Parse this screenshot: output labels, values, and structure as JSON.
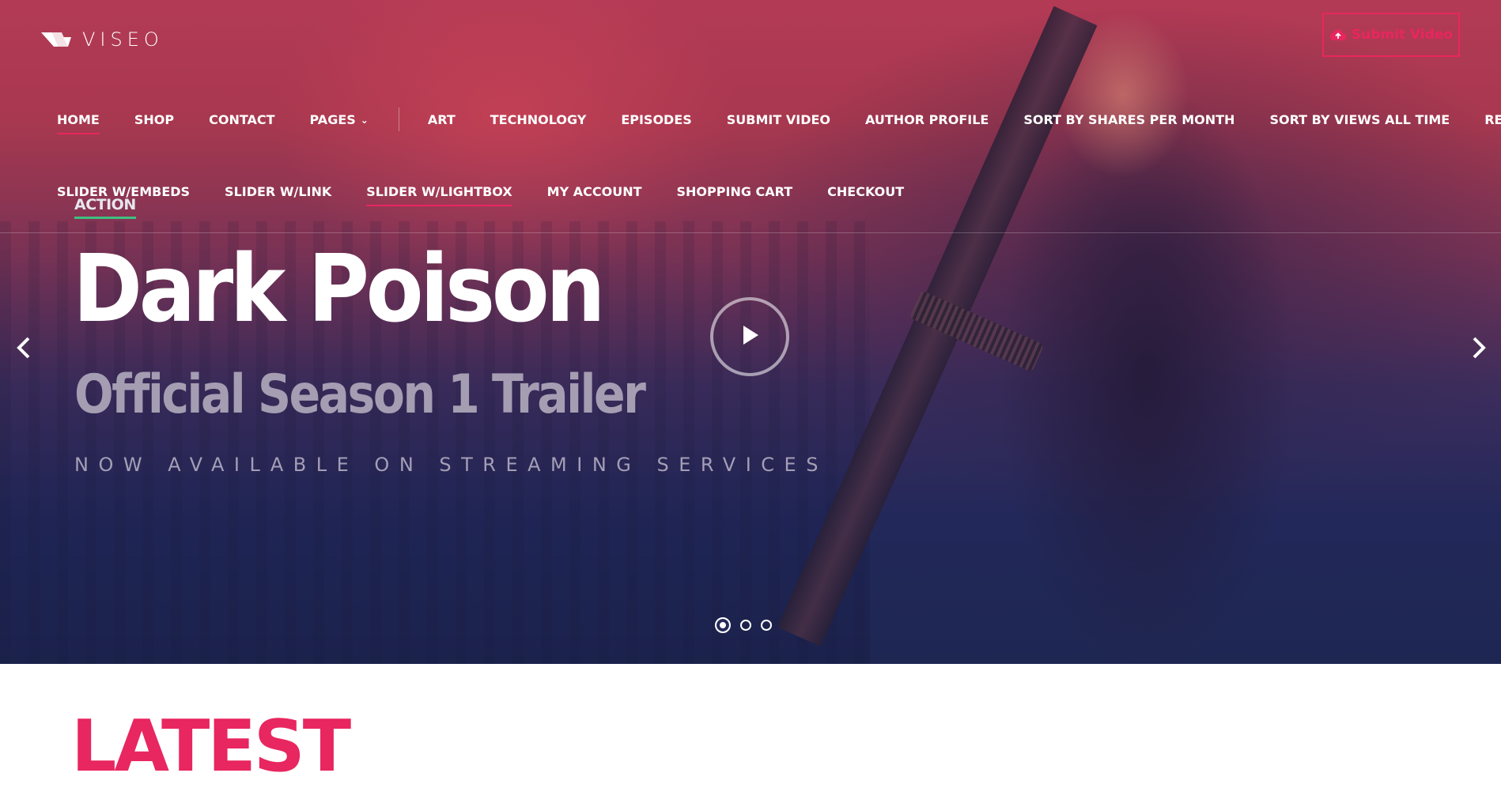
{
  "brand": {
    "name": "VISEO"
  },
  "header": {
    "submit_label": "Submit Video"
  },
  "nav": {
    "row1": [
      {
        "label": "HOME"
      },
      {
        "label": "SHOP"
      },
      {
        "label": "CONTACT"
      },
      {
        "label": "PAGES"
      },
      {
        "label": "ART"
      },
      {
        "label": "TECHNOLOGY"
      },
      {
        "label": "EPISODES"
      },
      {
        "label": "SUBMIT VIDEO"
      },
      {
        "label": "AUTHOR PROFILE"
      },
      {
        "label": "SORT BY SHARES PER MONTH"
      },
      {
        "label": "SORT BY VIEWS ALL TIME"
      },
      {
        "label": "REGISTER"
      }
    ],
    "row2": [
      {
        "label": "SLIDER W/EMBEDS"
      },
      {
        "label": "SLIDER W/LINK"
      },
      {
        "label": "SLIDER W/LIGHTBOX"
      },
      {
        "label": "MY ACCOUNT"
      },
      {
        "label": "SHOPPING CART"
      },
      {
        "label": "CHECKOUT"
      }
    ]
  },
  "slide": {
    "category": "ACTION",
    "title": "Dark Poison",
    "subtitle": "Official Season 1 Trailer",
    "tagline": "NOW AVAILABLE ON STREAMING SERVICES",
    "total_slides": 3,
    "current_slide": 1
  },
  "section": {
    "heading": "LATEST"
  },
  "colors": {
    "accent": "#e8265f",
    "category_underline": "#3fbf7f",
    "hero_dark": "#1e2752",
    "hero_red": "#b33a55"
  },
  "icons": {
    "upload": "cloud-upload-icon",
    "play": "play-icon",
    "prev": "chevron-left-icon",
    "next": "chevron-right-icon",
    "dropdown": "chevron-down-icon"
  }
}
